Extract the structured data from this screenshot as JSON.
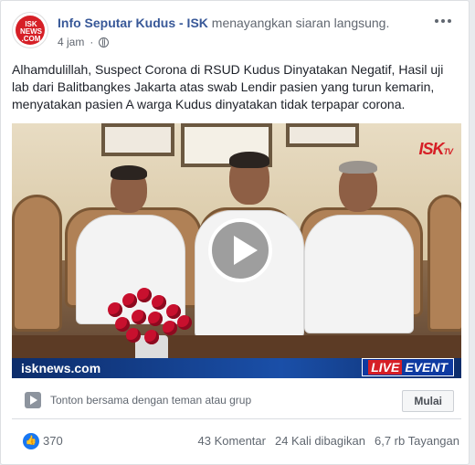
{
  "post": {
    "page_name": "Info Seputar Kudus - ISK",
    "action": "menayangkan siaran langsung.",
    "time": "4 jam",
    "avatar_text": [
      "ISK",
      "NEWS",
      ".COM"
    ],
    "text": "Alhamdulillah, Suspect Corona di RSUD Kudus Dinyatakan Negatif, Hasil uji lab dari Balitbangkes Jakarta atas swab Lendir pasien yang turun kemarin, menyatakan pasien A warga Kudus dinyatakan tidak terpapar corona."
  },
  "video": {
    "watermark": "ISK",
    "watermark_suffix": "TV",
    "site": "isknews.com",
    "live": "LIVE",
    "event": "EVENT"
  },
  "watch_together": {
    "text": "Tonton bersama dengan teman atau grup",
    "button": "Mulai"
  },
  "stats": {
    "likes": "370",
    "comments": "43 Komentar",
    "shares": "24 Kali dibagikan",
    "views": "6,7 rb Tayangan"
  },
  "colors": {
    "page_name": "#385898",
    "like": "#1877f2",
    "live_red": "#d61f26",
    "live_blue": "#0e3aa1"
  }
}
